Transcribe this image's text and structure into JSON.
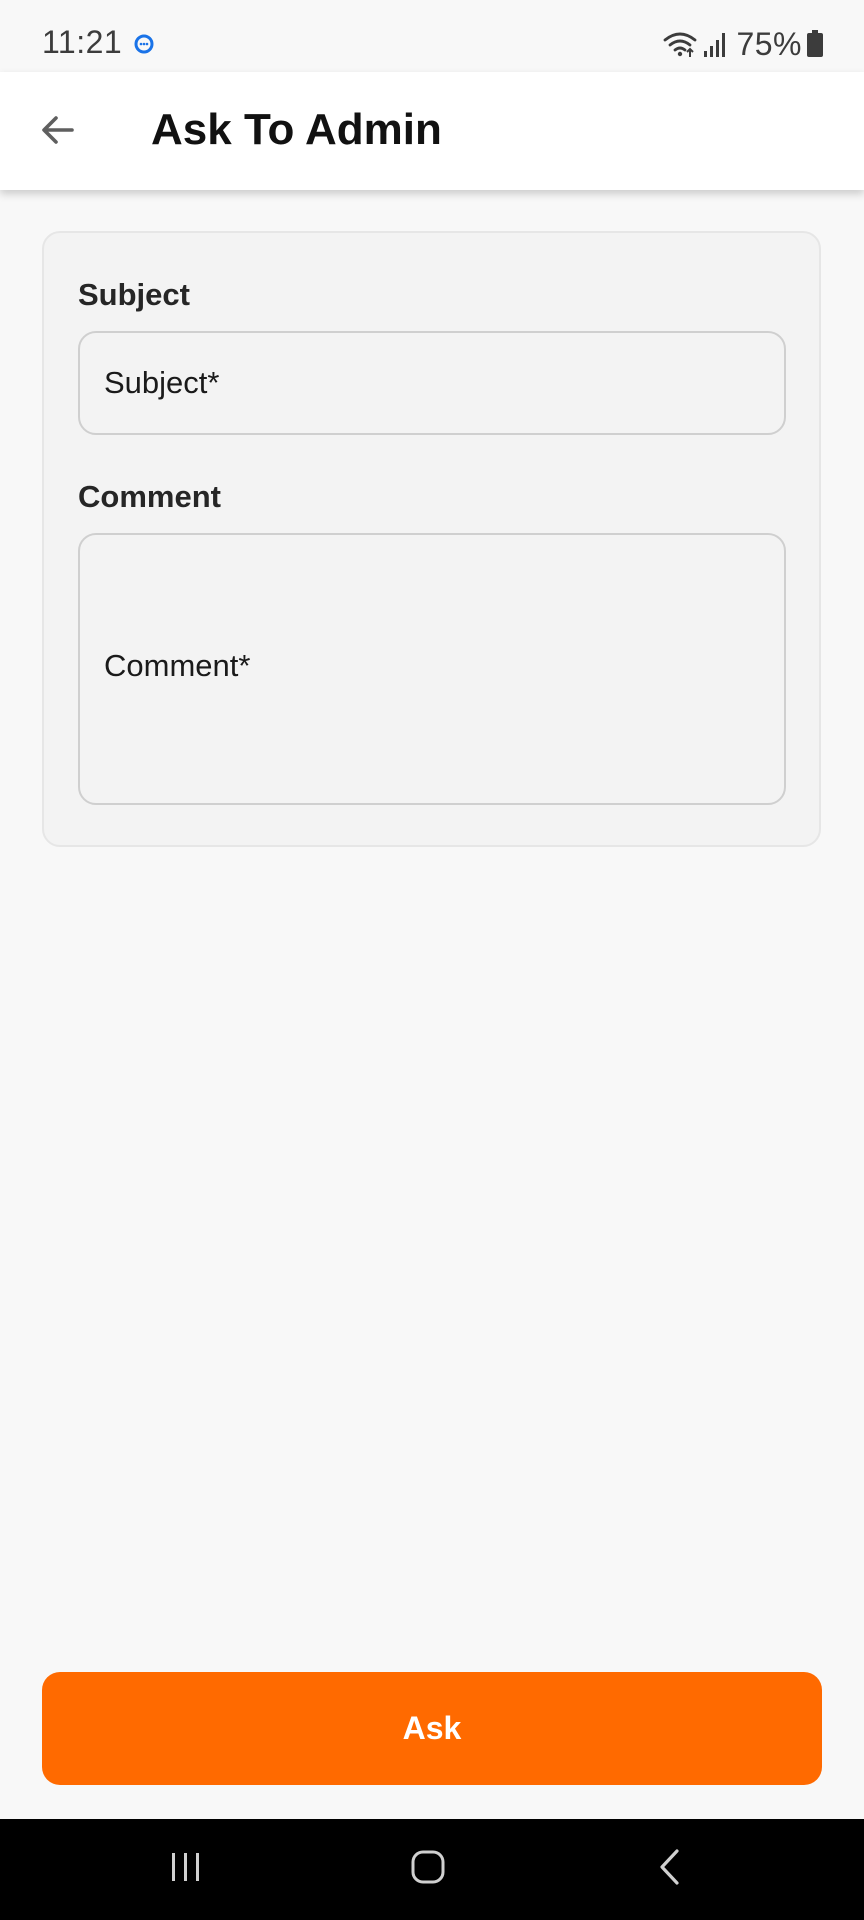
{
  "status_bar": {
    "time": "11:21",
    "battery": "75%",
    "icons": [
      "message-icon",
      "wifi-icon",
      "signal-icon",
      "battery-icon"
    ]
  },
  "app_bar": {
    "title": "Ask To Admin",
    "back_icon": "arrow-left-icon"
  },
  "form": {
    "subject": {
      "label": "Subject",
      "placeholder": "Subject*",
      "value": ""
    },
    "comment": {
      "label": "Comment",
      "placeholder": "Comment*",
      "value": ""
    }
  },
  "actions": {
    "ask_label": "Ask"
  },
  "nav_bar": {
    "icons": [
      "recents-icon",
      "home-icon",
      "back-icon"
    ]
  },
  "colors": {
    "accent": "#ff6a00",
    "background": "#f8f8f8",
    "card": "#f3f3f3",
    "message_icon": "#1a73e8"
  }
}
